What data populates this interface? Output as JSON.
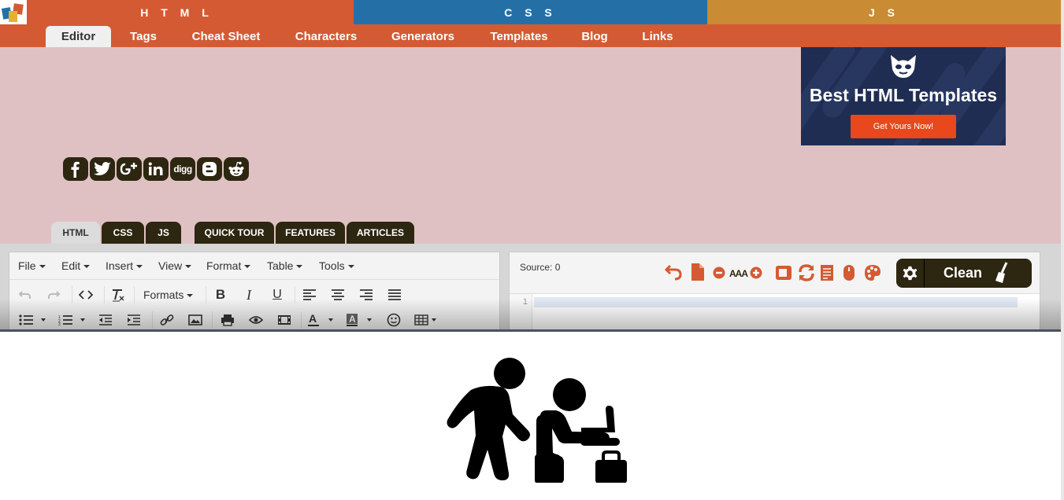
{
  "topbar": {
    "sections": [
      {
        "label": "H T M L",
        "color": "#d45a33"
      },
      {
        "label": "C S S",
        "color": "#2470a6"
      },
      {
        "label": "J S",
        "color": "#c98b33"
      }
    ]
  },
  "nav": {
    "items": [
      "Editor",
      "Tags",
      "Cheat Sheet",
      "Characters",
      "Generators",
      "Templates",
      "Blog",
      "Links"
    ]
  },
  "ad": {
    "title": "Best HTML Templates",
    "button": "Get Yours Now!"
  },
  "social": [
    "facebook-icon",
    "twitter-icon",
    "google-plus-icon",
    "linkedin-icon",
    "digg-icon",
    "blogger-icon",
    "reddit-icon"
  ],
  "social_digg_text": "digg",
  "tabs": [
    "HTML",
    "CSS",
    "JS",
    "QUICK TOUR",
    "FEATURES",
    "ARTICLES"
  ],
  "editor": {
    "menus": [
      "File",
      "Edit",
      "Insert",
      "View",
      "Format",
      "Table",
      "Tools"
    ],
    "formats_label": "Formats"
  },
  "source": {
    "label": "Source: 0",
    "font_size_label": "AAA",
    "line_number": "1",
    "clean_label": "Clean"
  },
  "colors": {
    "accent": "#d45a33",
    "dark": "#2d2610",
    "hero": "#e0c1c3"
  }
}
